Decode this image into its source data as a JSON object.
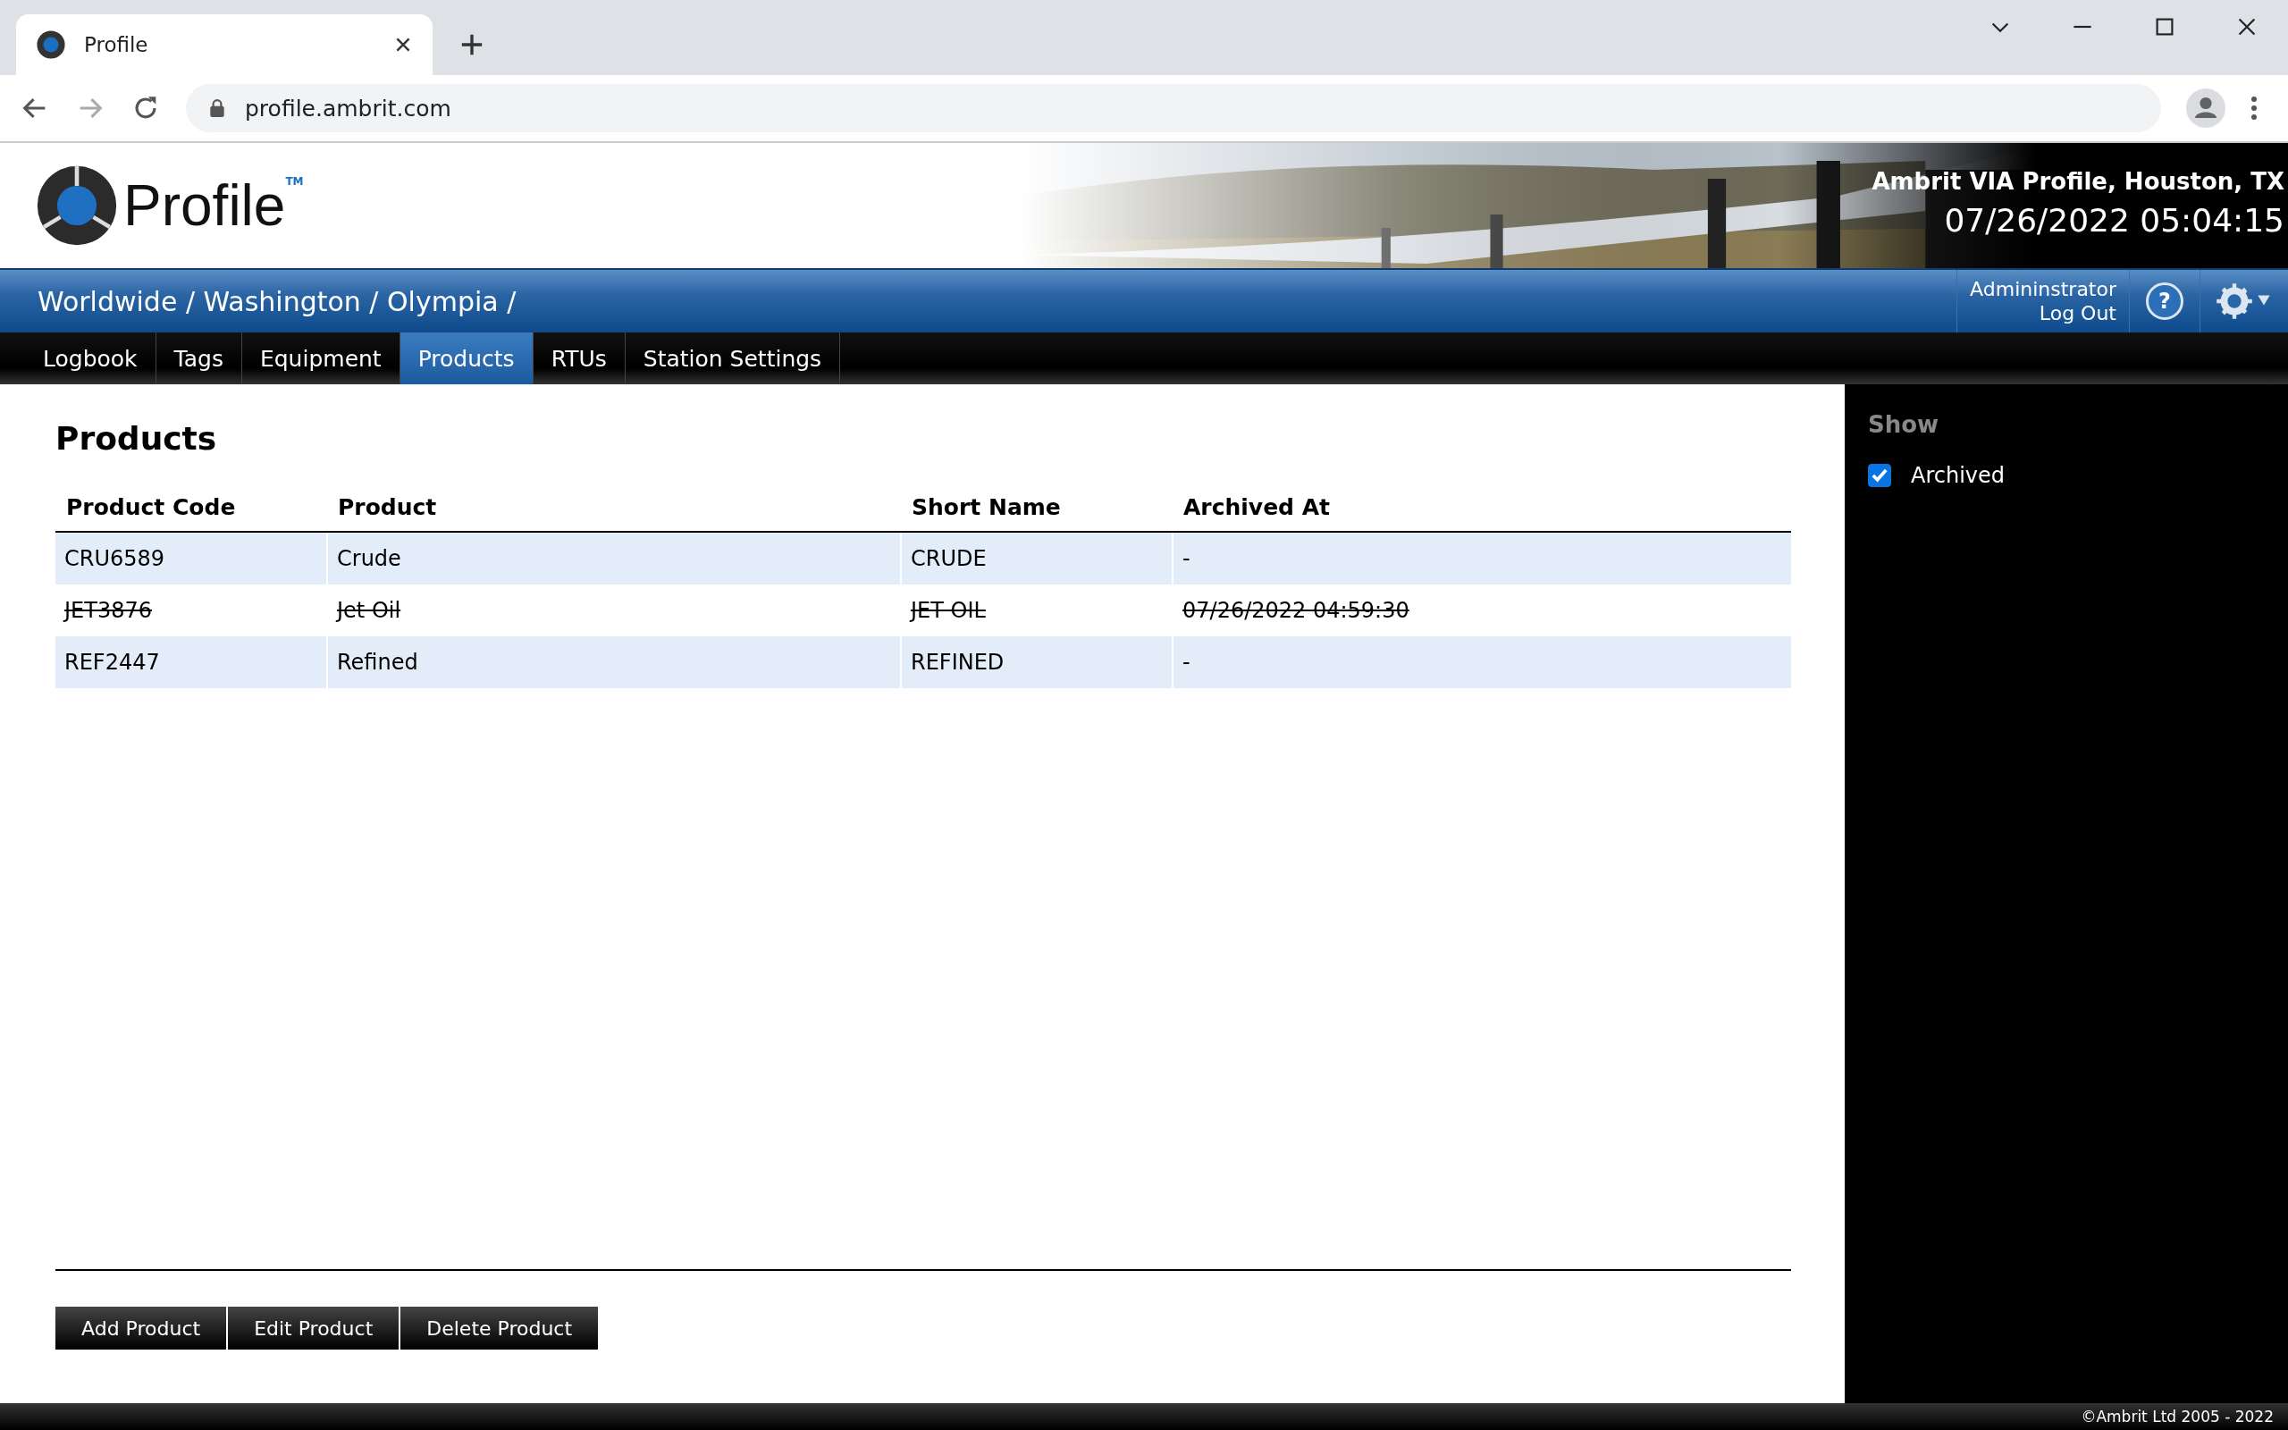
{
  "browser": {
    "tab_title": "Profile",
    "url": "profile.ambrit.com"
  },
  "header": {
    "logo_text": "Profile",
    "trademark": "TM",
    "site_name": "Ambrit VIA Profile, Houston, TX",
    "datetime": "07/26/2022 05:04:15"
  },
  "breadcrumb": "Worldwide / Washington / Olympia /",
  "user": {
    "name": "Admininstrator",
    "logout": "Log Out",
    "help": "?"
  },
  "tabs": [
    {
      "label": "Logbook",
      "selected": false
    },
    {
      "label": "Tags",
      "selected": false
    },
    {
      "label": "Equipment",
      "selected": false
    },
    {
      "label": "Products",
      "selected": true
    },
    {
      "label": "RTUs",
      "selected": false
    },
    {
      "label": "Station Settings",
      "selected": false
    }
  ],
  "page_title": "Products",
  "table": {
    "columns": [
      "Product Code",
      "Product",
      "Short Name",
      "Archived At"
    ],
    "rows": [
      {
        "cells": [
          "CRU6589",
          "Crude",
          "CRUDE",
          "-"
        ],
        "archived": false
      },
      {
        "cells": [
          "JET3876",
          "Jet Oil",
          "JET OIL",
          "07/26/2022 04:59:30"
        ],
        "archived": true
      },
      {
        "cells": [
          "REF2447",
          "Refined",
          "REFINED",
          "-"
        ],
        "archived": false
      }
    ]
  },
  "buttons": [
    "Add Product",
    "Edit Product",
    "Delete Product"
  ],
  "sidebar": {
    "title": "Show",
    "options": [
      {
        "label": "Archived",
        "checked": true
      }
    ]
  },
  "footer": "©Ambrit Ltd 2005 - 2022"
}
